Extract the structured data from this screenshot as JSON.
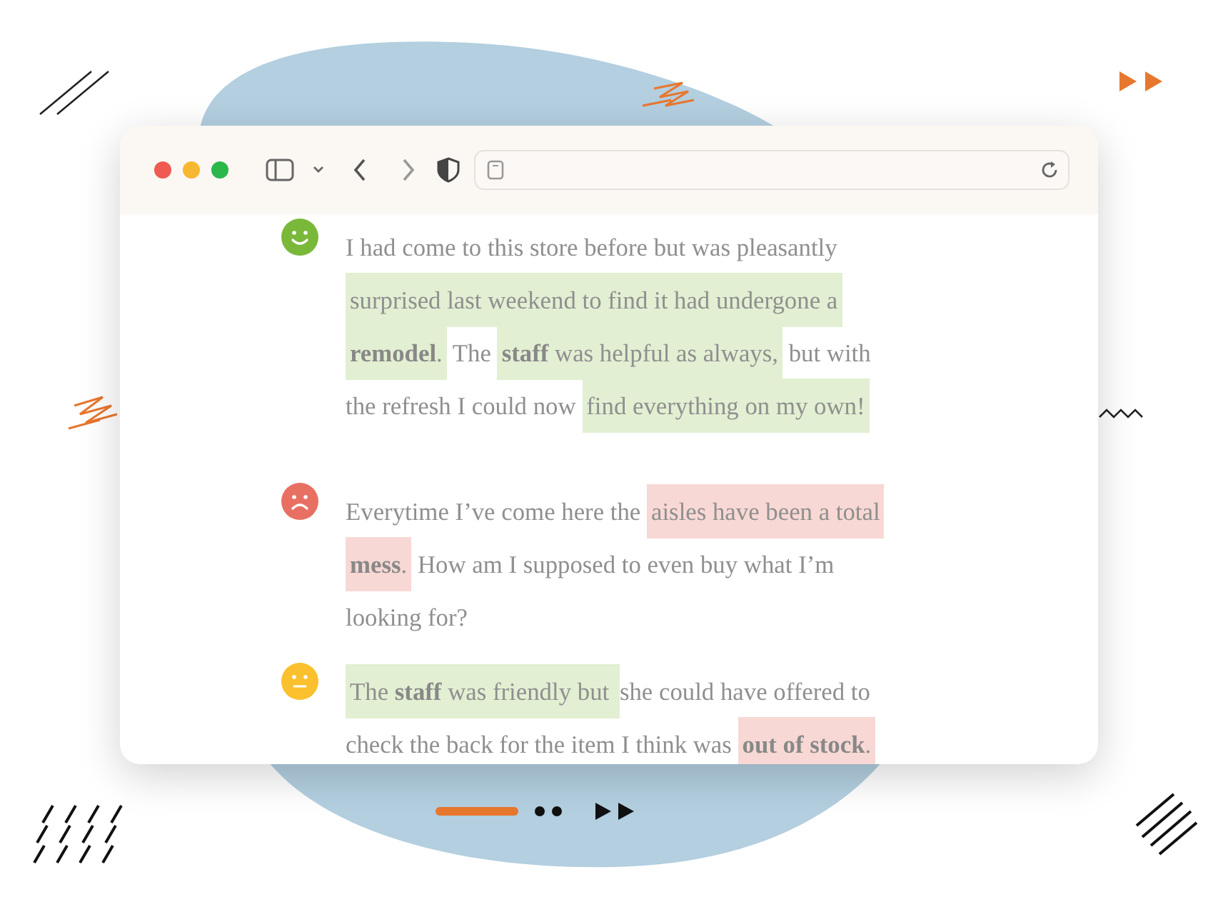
{
  "reviews": [
    {
      "kind": "positive",
      "segments": [
        {
          "text": "I had come to this store before but was pleasantly ",
          "kind": "plain"
        },
        {
          "text": "surprised last weekend to find it had undergone a **remodel**.",
          "kind": "positive"
        },
        {
          "text": " The ",
          "kind": "plain"
        },
        {
          "text": "**staff** was helpful as always,",
          "kind": "positive"
        },
        {
          "text": " but with the refresh I could now ",
          "kind": "plain"
        },
        {
          "text": "find everything on my own!",
          "kind": "positive"
        }
      ]
    },
    {
      "kind": "negative",
      "segments": [
        {
          "text": "Everytime I’ve come here the ",
          "kind": "plain"
        },
        {
          "text": "aisles have been a total **mess**.",
          "kind": "negative"
        },
        {
          "text": " How am I supposed to even buy what I’m looking for?",
          "kind": "plain"
        }
      ]
    },
    {
      "kind": "neutral",
      "segments": [
        {
          "text": "The **staff** was friendly but ",
          "kind": "positive"
        },
        {
          "text": "she could have offered to check the back for the item I think was ",
          "kind": "plain"
        },
        {
          "text": "**out of stock**.",
          "kind": "negative"
        }
      ]
    }
  ]
}
